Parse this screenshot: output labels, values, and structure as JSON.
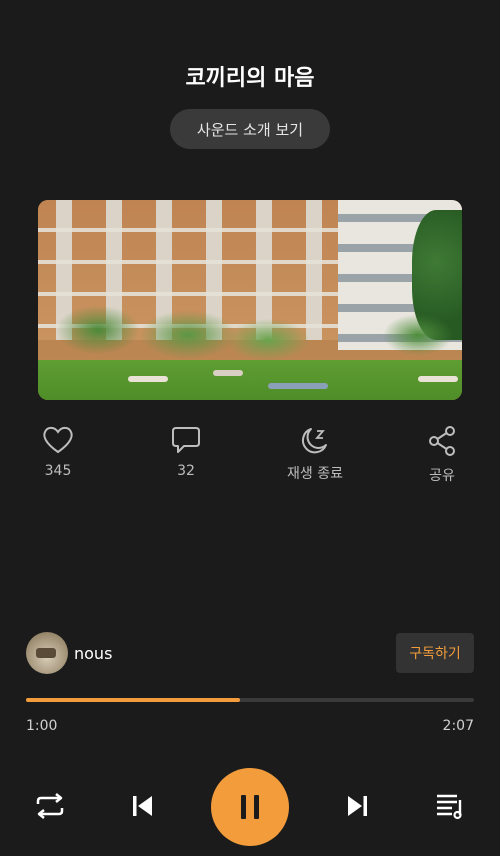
{
  "sound": {
    "title": "코끼리의 마음",
    "intro_label": "사운드 소개 보기"
  },
  "actions": {
    "like_count": "345",
    "comment_count": "32",
    "sleep_timer_label": "재생 종료",
    "share_label": "공유"
  },
  "author": {
    "name": "nous",
    "subscribe_label": "구독하기"
  },
  "playback": {
    "current_time": "1:00",
    "total_time": "2:07",
    "progress_fraction": 0.478
  },
  "colors": {
    "background": "#1b1b1b",
    "accent": "#f39c3c"
  },
  "icons": {
    "like": "heart-icon",
    "comment": "chat-bubble-icon",
    "sleep": "moon-zz-icon",
    "share": "share-icon",
    "repeat": "repeat-icon",
    "previous": "skip-previous-icon",
    "pause": "pause-icon",
    "next": "skip-next-icon",
    "playlist": "playlist-icon"
  }
}
